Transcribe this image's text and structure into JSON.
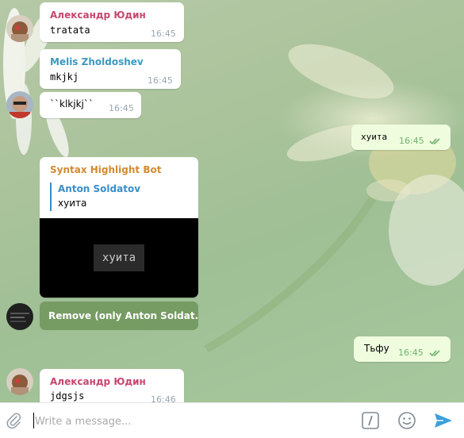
{
  "messages": {
    "m1": {
      "author": "Александр Юдин",
      "text": "tratata",
      "time": "16:45"
    },
    "m2": {
      "author": "Melis Zholdoshev",
      "text": "mkjkj",
      "time": "16:45"
    },
    "m3": {
      "text": "``klkjkj``",
      "time": "16:45"
    },
    "m4": {
      "text": "хуита",
      "time": "16:45"
    },
    "bot": {
      "author": "Syntax Highlight Bot",
      "reply_author": "Anton Soldatov",
      "reply_text": "хуита",
      "code_preview": "хуита",
      "button_label": "Remove (only Anton Soldat..."
    },
    "m5": {
      "text": "Тьфу",
      "time": "16:45"
    },
    "m6": {
      "author": "Александр Юдин",
      "text": "jdgsjs",
      "time": "16:46"
    }
  },
  "composer": {
    "placeholder": "Write a message...",
    "icons": {
      "attach": "paperclip-icon",
      "commands": "slash-command-icon",
      "emoji": "smile-icon",
      "send": "send-icon"
    }
  },
  "colors": {
    "author_red": "#c7476e",
    "author_teal": "#3a9ac0",
    "bot_orange": "#d48a2f",
    "link_blue": "#3a8dc8",
    "out_bubble": "#effdde",
    "send_blue": "#3b9fe0"
  }
}
